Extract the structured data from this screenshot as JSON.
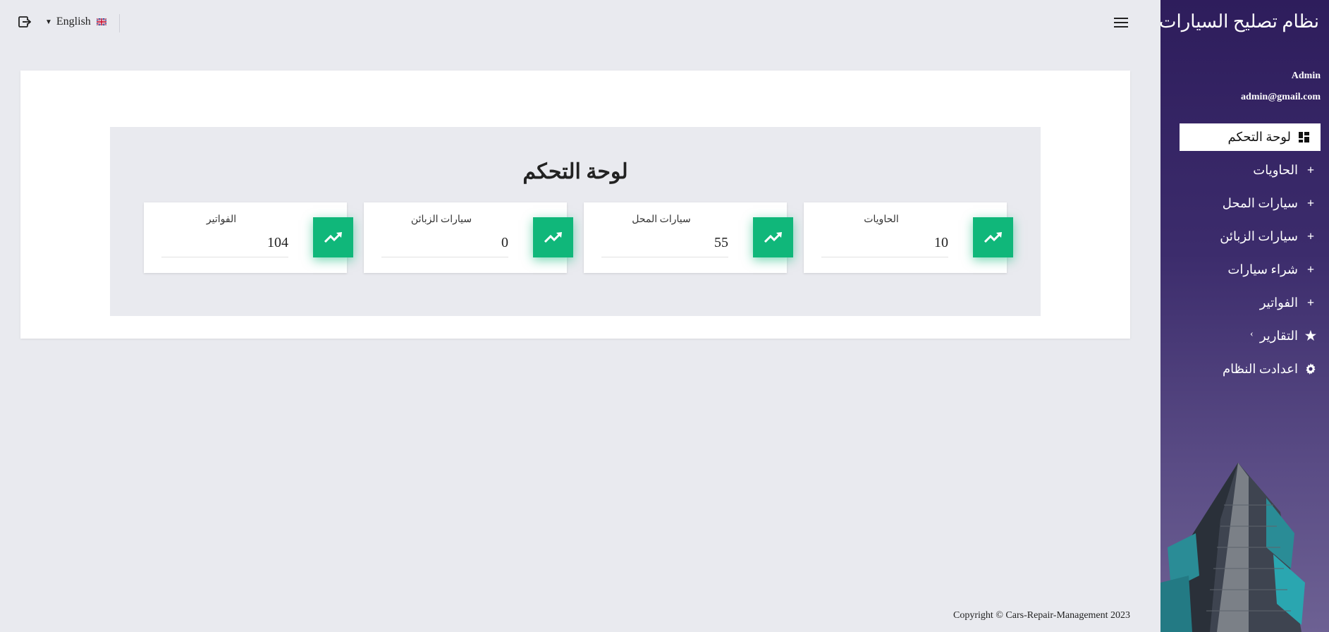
{
  "sidebar": {
    "brand": "نظام تصليح السيارات",
    "user_name": "Admin",
    "user_email": "admin@gmail.com",
    "items": [
      {
        "label": "لوحة التحكم",
        "icon": "dashboard-icon"
      },
      {
        "label": "الحاويات",
        "icon": "plus-icon"
      },
      {
        "label": "سيارات المحل",
        "icon": "plus-icon"
      },
      {
        "label": "سيارات الزبائن",
        "icon": "plus-icon"
      },
      {
        "label": "شراء سيارات",
        "icon": "plus-icon"
      },
      {
        "label": "الفواتير",
        "icon": "plus-icon"
      },
      {
        "label": "التقارير",
        "icon": "star-icon"
      },
      {
        "label": "اعدادت النظام",
        "icon": "gear-icon"
      }
    ]
  },
  "topbar": {
    "language": "English"
  },
  "dashboard": {
    "title": "لوحة التحكم",
    "stats": [
      {
        "label": "الفواتير",
        "value": "104"
      },
      {
        "label": "سيارات الزبائن",
        "value": "0"
      },
      {
        "label": "سيارات المحل",
        "value": "55"
      },
      {
        "label": "الحاويات",
        "value": "10"
      }
    ]
  },
  "footer": {
    "copyright": "Copyright © Cars-Repair-Management 2023"
  },
  "colors": {
    "accent_green": "#10b77a",
    "sidebar_purple": "#2e1d5c"
  }
}
